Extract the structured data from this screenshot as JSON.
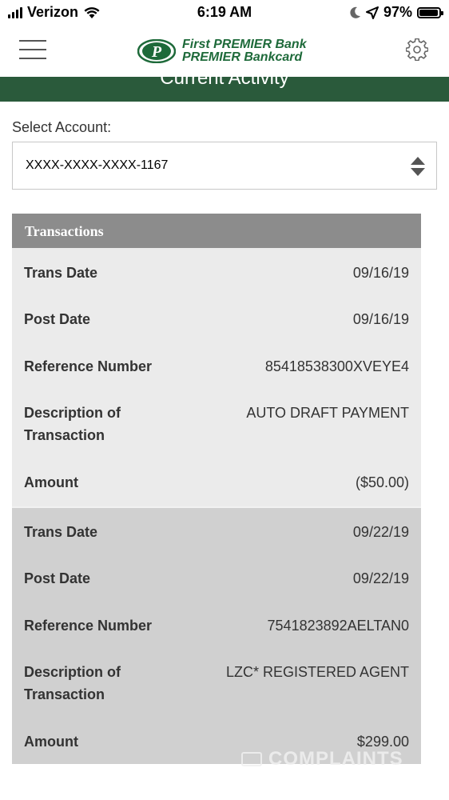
{
  "status_bar": {
    "carrier": "Verizon",
    "time": "6:19 AM",
    "battery": "97%",
    "battery_level": 0.97,
    "icons": [
      "signal-icon",
      "wifi-icon",
      "moon-icon",
      "location-arrow-icon",
      "battery-icon"
    ]
  },
  "header": {
    "logo_line1": "First PREMIER Bank",
    "logo_line2": "PREMIER Bankcard",
    "icons": [
      "menu-icon",
      "logo-icon",
      "gear-icon"
    ]
  },
  "page": {
    "title": "Current Activity"
  },
  "account": {
    "label": "Select Account:",
    "selected": "XXXX-XXXX-XXXX-1167"
  },
  "transactions": {
    "header": "Transactions",
    "labels": {
      "trans_date": "Trans Date",
      "post_date": "Post Date",
      "reference": "Reference Number",
      "description": "Description of Transaction",
      "amount": "Amount"
    },
    "items": [
      {
        "trans_date": "09/16/19",
        "post_date": "09/16/19",
        "reference": "85418538300XVEYE4",
        "description": "AUTO DRAFT PAYMENT",
        "amount": "($50.00)"
      },
      {
        "trans_date": "09/22/19",
        "post_date": "09/22/19",
        "reference": "7541823892AELTAN0",
        "description": "LZC* REGISTERED AGENT",
        "amount": "$299.00"
      }
    ]
  },
  "watermark": "COMPLAINTS",
  "colors": {
    "brand_green": "#2a5a3b",
    "logo_green": "#1e6a3a",
    "table_header": "#8c8c8c",
    "row_light": "#ebebeb",
    "row_dark": "#d0d0d0"
  }
}
